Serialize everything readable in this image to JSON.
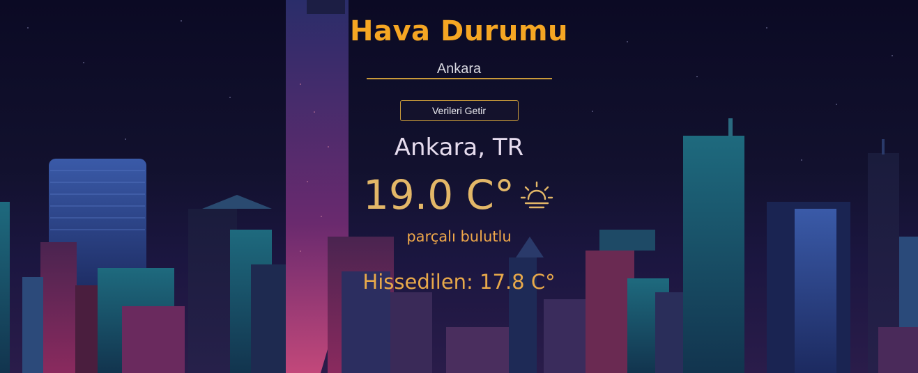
{
  "app": {
    "title": "Hava Durumu"
  },
  "search": {
    "value": "Ankara",
    "button_label": "Verileri Getir"
  },
  "weather": {
    "location": "Ankara, TR",
    "temperature": "19.0 C°",
    "icon": "partly-sunny-icon",
    "description": "parçalı bulutlu",
    "feels_like": "Hissedilen: 17.8 C°"
  },
  "colors": {
    "accent": "#f5a623",
    "temperature": "#e3b768",
    "background": "#0b0a24"
  }
}
